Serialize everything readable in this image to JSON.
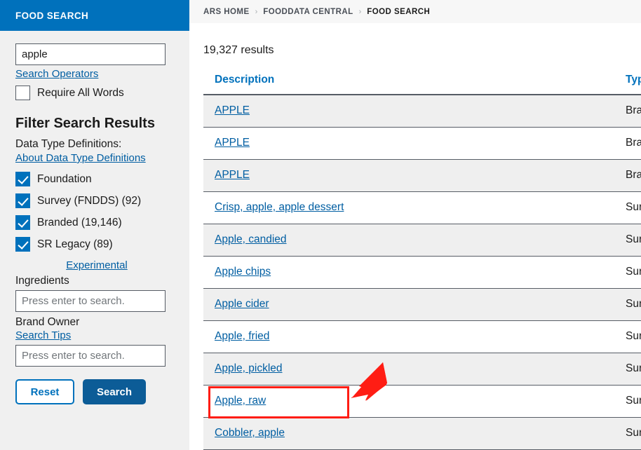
{
  "sidebar": {
    "header_title": "FOOD SEARCH",
    "search_input_value": "apple",
    "search_operators_link": "Search Operators",
    "require_all_words_label": "Require All Words",
    "require_all_words_checked": false,
    "filter_title": "Filter Search Results",
    "data_type_definitions_label": "Data Type Definitions:",
    "about_data_type_definitions_link": "About Data Type Definitions",
    "data_types": [
      {
        "label": "Foundation",
        "checked": true
      },
      {
        "label": "Survey (FNDDS) (92)",
        "checked": true
      },
      {
        "label": "Branded (19,146)",
        "checked": true
      },
      {
        "label": "SR Legacy (89)",
        "checked": true
      }
    ],
    "experimental_link": "Experimental",
    "ingredients_label": "Ingredients",
    "ingredients_placeholder": "Press enter to search.",
    "ingredients_value": "",
    "brand_owner_label": "Brand Owner",
    "search_tips_link": "Search Tips",
    "brand_owner_placeholder": "Press enter to search.",
    "brand_owner_value": "",
    "reset_button": "Reset",
    "search_button": "Search"
  },
  "breadcrumb": {
    "items": [
      "ARS HOME",
      "FOODDATA CENTRAL",
      "FOOD SEARCH"
    ],
    "separator": "›"
  },
  "main": {
    "results_count": "19,327 results",
    "columns": [
      "Description",
      "Type"
    ],
    "rows": [
      {
        "description": "APPLE",
        "type": "Branded"
      },
      {
        "description": "APPLE",
        "type": "Branded"
      },
      {
        "description": "APPLE",
        "type": "Branded"
      },
      {
        "description": "Crisp, apple, apple dessert",
        "type": "Survey (FNDDS)"
      },
      {
        "description": "Apple, candied",
        "type": "Survey (FNDDS)"
      },
      {
        "description": "Apple chips",
        "type": "Survey (FNDDS)"
      },
      {
        "description": "Apple cider",
        "type": "Survey (FNDDS)"
      },
      {
        "description": "Apple, fried",
        "type": "Survey (FNDDS)"
      },
      {
        "description": "Apple, pickled",
        "type": "Survey (FNDDS)"
      },
      {
        "description": "Apple, raw",
        "type": "Survey (FNDDS)"
      },
      {
        "description": "Cobbler, apple",
        "type": "Survey (FNDDS)"
      }
    ]
  },
  "annotation": {
    "highlighted_row_description": "Apple, raw",
    "arrow_color": "#ff1d14",
    "box_color": "#ff1d14"
  },
  "colors": {
    "header_blue": "#0071bc",
    "link_blue": "#005ea2",
    "button_blue": "#0c5c97",
    "sidebar_bg": "#f0f0f0",
    "row_alt_bg": "#efefef",
    "annotation_red": "#ff1d14"
  }
}
